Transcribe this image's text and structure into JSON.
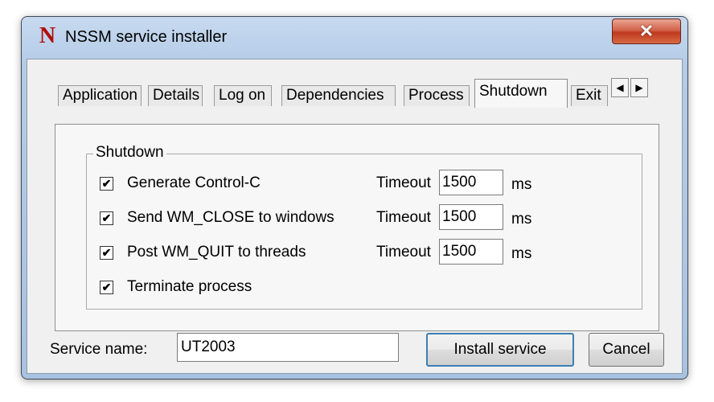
{
  "window": {
    "title": "NSSM service installer",
    "app_icon_glyph": "N",
    "close_glyph": "✕"
  },
  "tabs": [
    {
      "label": "Application",
      "active": false
    },
    {
      "label": "Details",
      "active": false
    },
    {
      "label": "Log on",
      "active": false
    },
    {
      "label": "Dependencies",
      "active": false
    },
    {
      "label": "Process",
      "active": false
    },
    {
      "label": "Shutdown",
      "active": true
    },
    {
      "label": "Exit",
      "active": false
    }
  ],
  "tab_scroll": {
    "left_glyph": "◀",
    "right_glyph": "▶"
  },
  "shutdown": {
    "group_label": "Shutdown",
    "timeout_label": "Timeout",
    "unit": "ms",
    "options": [
      {
        "label": "Generate Control-C",
        "checked": true,
        "timeout": "1500"
      },
      {
        "label": "Send WM_CLOSE to windows",
        "checked": true,
        "timeout": "1500"
      },
      {
        "label": "Post WM_QUIT to threads",
        "checked": true,
        "timeout": "1500"
      },
      {
        "label": "Terminate process",
        "checked": true
      }
    ]
  },
  "footer": {
    "service_name_label": "Service name:",
    "service_name_value": "UT2003",
    "install_label": "Install service",
    "cancel_label": "Cancel"
  },
  "colors": {
    "titlebar": "#b4cbe6",
    "close_button": "#c0391f",
    "icon_red": "#b10d0d"
  }
}
